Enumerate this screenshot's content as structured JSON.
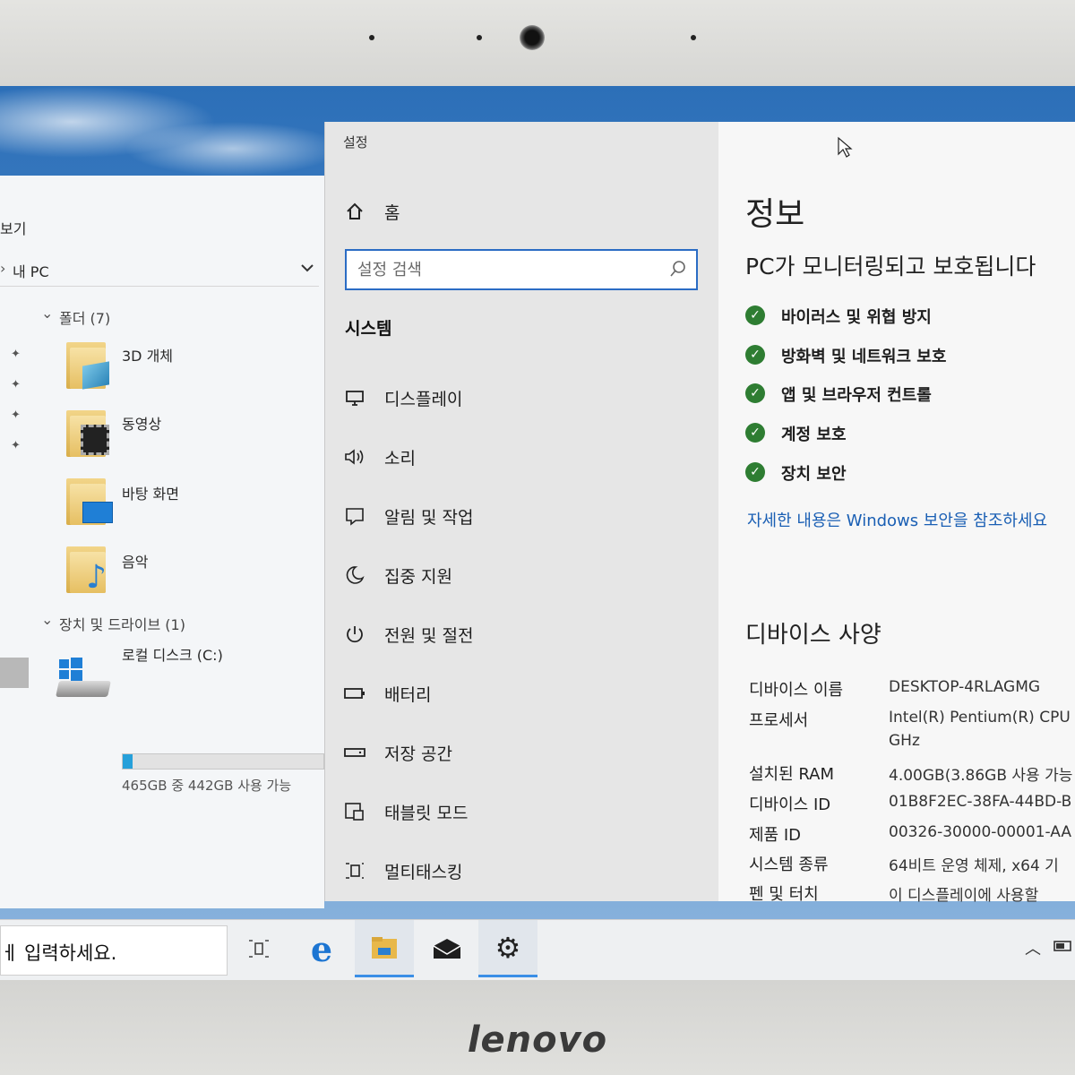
{
  "brand": "lenovo",
  "explorer": {
    "view_tab": "보기",
    "address": "내 PC",
    "folders_group": "폴더 (7)",
    "folders": [
      {
        "label": "3D 개체"
      },
      {
        "label": "동영상"
      },
      {
        "label": "바탕 화면"
      },
      {
        "label": "음악"
      }
    ],
    "devices_group": "장치 및 드라이브 (1)",
    "drive": {
      "label": "로컬 디스크 (C:)",
      "free_text": "465GB 중 442GB 사용 가능",
      "used_fraction": 0.05
    }
  },
  "settings": {
    "window_title": "설정",
    "home_label": "홈",
    "search_placeholder": "설정 검색",
    "category": "시스템",
    "nav_items": [
      {
        "label": "디스플레이",
        "icon": "monitor-icon"
      },
      {
        "label": "소리",
        "icon": "speaker-icon"
      },
      {
        "label": "알림 및 작업",
        "icon": "notification-icon"
      },
      {
        "label": "집중 지원",
        "icon": "moon-icon"
      },
      {
        "label": "전원 및 절전",
        "icon": "power-icon"
      },
      {
        "label": "배터리",
        "icon": "battery-icon"
      },
      {
        "label": "저장 공간",
        "icon": "storage-icon"
      },
      {
        "label": "태블릿 모드",
        "icon": "tablet-icon"
      },
      {
        "label": "멀티태스킹",
        "icon": "multitask-icon"
      }
    ],
    "main": {
      "title": "정보",
      "subtitle": "PC가 모니터링되고 보호됩니다",
      "security_items": [
        "바이러스 및 위협 방지",
        "방화벽 및 네트워크 보호",
        "앱 및 브라우저 컨트롤",
        "계정 보호",
        "장치 보안"
      ],
      "security_link": "자세한 내용은 Windows 보안을 참조하세요",
      "spec_title": "디바이스 사양",
      "specs": [
        {
          "key": "디바이스 이름",
          "value": "DESKTOP-4RLAGMG"
        },
        {
          "key": "프로세서",
          "value": "Intel(R) Pentium(R) CPU",
          "value2": "GHz"
        },
        {
          "key": "설치된 RAM",
          "value": "4.00GB(3.86GB 사용 가능"
        },
        {
          "key": "디바이스 ID",
          "value": "01B8F2EC-38FA-44BD-B"
        },
        {
          "key": "제품 ID",
          "value": "00326-30000-00001-AA"
        },
        {
          "key": "시스템 종류",
          "value": "64비트 운영 체제, x64 기"
        },
        {
          "key": "펜 및 터치",
          "value": "이 디스플레이에 사용할"
        }
      ]
    }
  },
  "taskbar": {
    "search_text": "ㅔ 입력하세요."
  }
}
